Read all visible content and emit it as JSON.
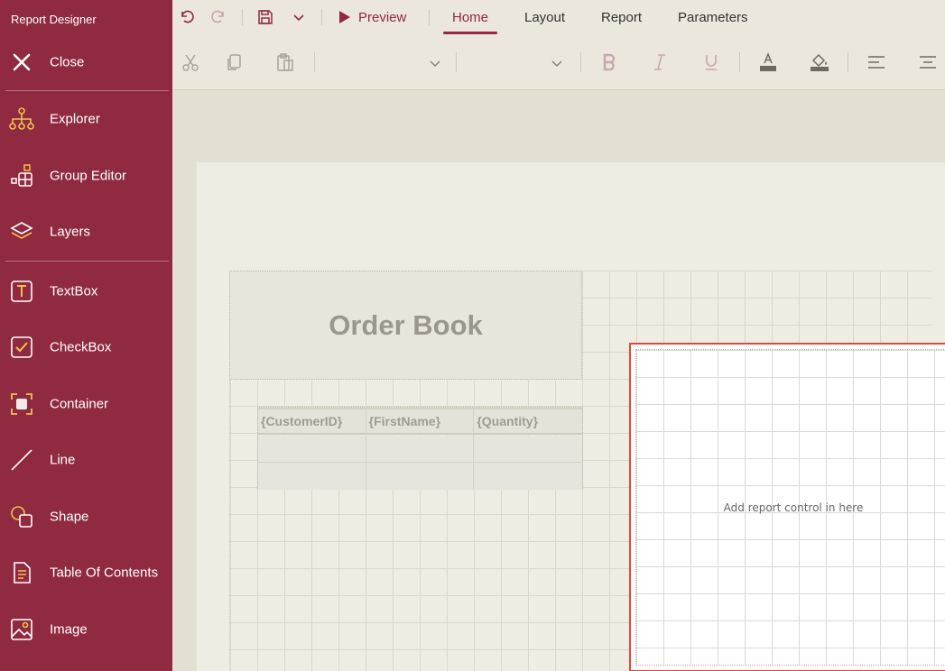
{
  "app": {
    "title": "Report Designer"
  },
  "sidebar": {
    "close": {
      "label": "Close",
      "icon": "close-icon"
    },
    "items": [
      {
        "label": "Explorer",
        "icon": "tree-icon"
      },
      {
        "label": "Group Editor",
        "icon": "group-editor-icon"
      },
      {
        "label": "Layers",
        "icon": "layers-icon"
      },
      {
        "label": "TextBox",
        "icon": "textbox-icon"
      },
      {
        "label": "CheckBox",
        "icon": "checkbox-icon"
      },
      {
        "label": "Container",
        "icon": "container-icon"
      },
      {
        "label": "Line",
        "icon": "line-icon"
      },
      {
        "label": "Shape",
        "icon": "shape-icon"
      },
      {
        "label": "Table Of Contents",
        "icon": "document-icon"
      },
      {
        "label": "Image",
        "icon": "image-icon"
      }
    ]
  },
  "toolbar": {
    "preview_label": "Preview",
    "tabs": [
      "Home",
      "Layout",
      "Report",
      "Parameters"
    ],
    "active_tab": "Home"
  },
  "report": {
    "title": "Order Book",
    "table_headers": [
      "{CustomerID}",
      "{FirstName}",
      "{Quantity}"
    ],
    "container_placeholder": "Add report control in here"
  },
  "colors": {
    "brand": "#8f2a40",
    "accent_icon": "#f0c14b",
    "selection": "#e0483e",
    "canvas": "#e3dfd2",
    "page": "#efece4"
  }
}
